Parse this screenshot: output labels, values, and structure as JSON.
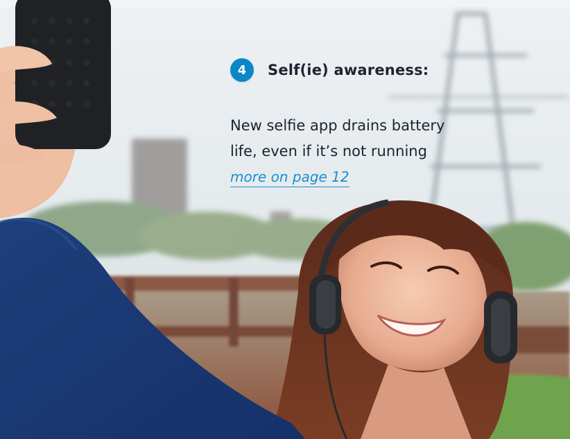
{
  "feature": {
    "number": "4",
    "title": "Self(ie) awareness:",
    "body_lines": [
      "New selfie app drains battery",
      "life, even if it’s not running"
    ],
    "link_text": "more on page 12"
  },
  "colors": {
    "badge": "#0b86c9",
    "link": "#1b8fd3",
    "text": "#1c2330"
  },
  "image": {
    "subject": "woman-taking-selfie-with-headphones"
  }
}
